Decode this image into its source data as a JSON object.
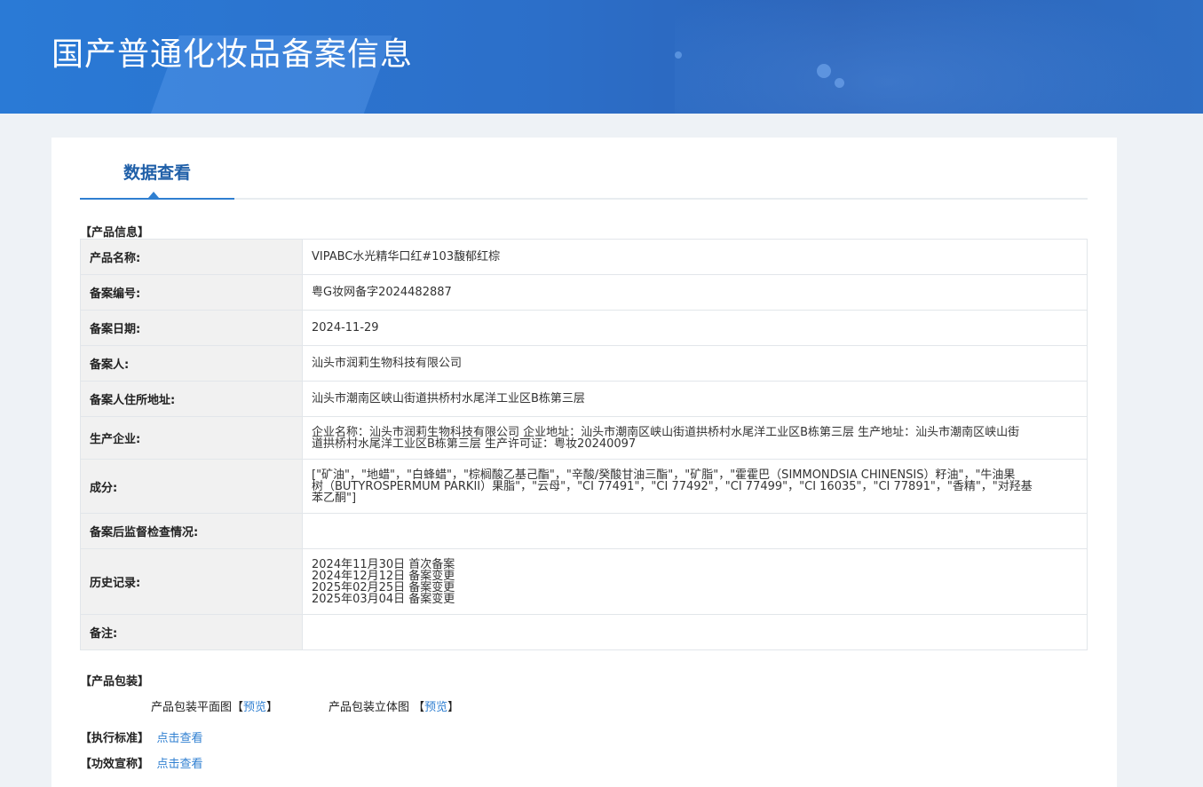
{
  "header": {
    "title": "国产普通化妆品备案信息"
  },
  "tabs": [
    {
      "label": "数据查看"
    }
  ],
  "sections": {
    "product_info": "【产品信息】",
    "packaging": "【产品包装】",
    "standard": "【执行标准】",
    "efficacy": "【功效宣称】"
  },
  "product": {
    "name_label": "产品名称:",
    "name": "VIPABC水光精华口红#103馥郁红棕",
    "reg_no_label": "备案编号:",
    "reg_no": "粤G妆网备字2024482887",
    "date_label": "备案日期:",
    "date": "2024-11-29",
    "applicant_label": "备案人:",
    "applicant": "汕头市润莉生物科技有限公司",
    "address_label": "备案人住所地址:",
    "address": "汕头市潮南区峡山街道拱桥村水尾洋工业区B栋第三层",
    "manufacturer_label": "生产企业:",
    "manufacturer_lines": [
      "企业名称：汕头市润莉生物科技有限公司 企业地址：汕头市潮南区峡山街道拱桥村水尾洋工业区B栋第三层 生产地址：汕头市潮南区峡山街",
      "道拱桥村水尾洋工业区B栋第三层 生产许可证：粤妆20240097"
    ],
    "ingredients_label": "成分:",
    "ingredients_lines": [
      "[\"矿油\"，\"地蜡\"，\"白蜂蜡\"，\"棕榈酸乙基己酯\"，\"辛酸/癸酸甘油三酯\"，\"矿脂\"，\"霍霍巴（SIMMONDSIA CHINENSIS）籽油\"，\"牛油果",
      "树（BUTYROSPERMUM PARKII）果脂\"，\"云母\"，\"CI 77491\"，\"CI 77492\"，\"CI 77499\"，\"CI 16035\"，\"CI 77891\"，\"香精\"，\"对羟基",
      "苯乙酮\"]"
    ],
    "supervision_label": "备案后监督检查情况:",
    "supervision": "",
    "history_label": "历史记录:",
    "history": [
      "2024年11月30日 首次备案",
      "2024年12月12日 备案变更",
      "2025年02月25日 备案变更",
      "2025年03月04日 备案变更"
    ],
    "remarks_label": "备注:",
    "remarks": ""
  },
  "packaging": {
    "flat_label": "产品包装平面图",
    "flat_link": "预览",
    "solid_label": "产品包装立体图",
    "solid_link": "预览"
  },
  "standard": {
    "link": "点击查看"
  },
  "efficacy": {
    "link": "点击查看"
  }
}
